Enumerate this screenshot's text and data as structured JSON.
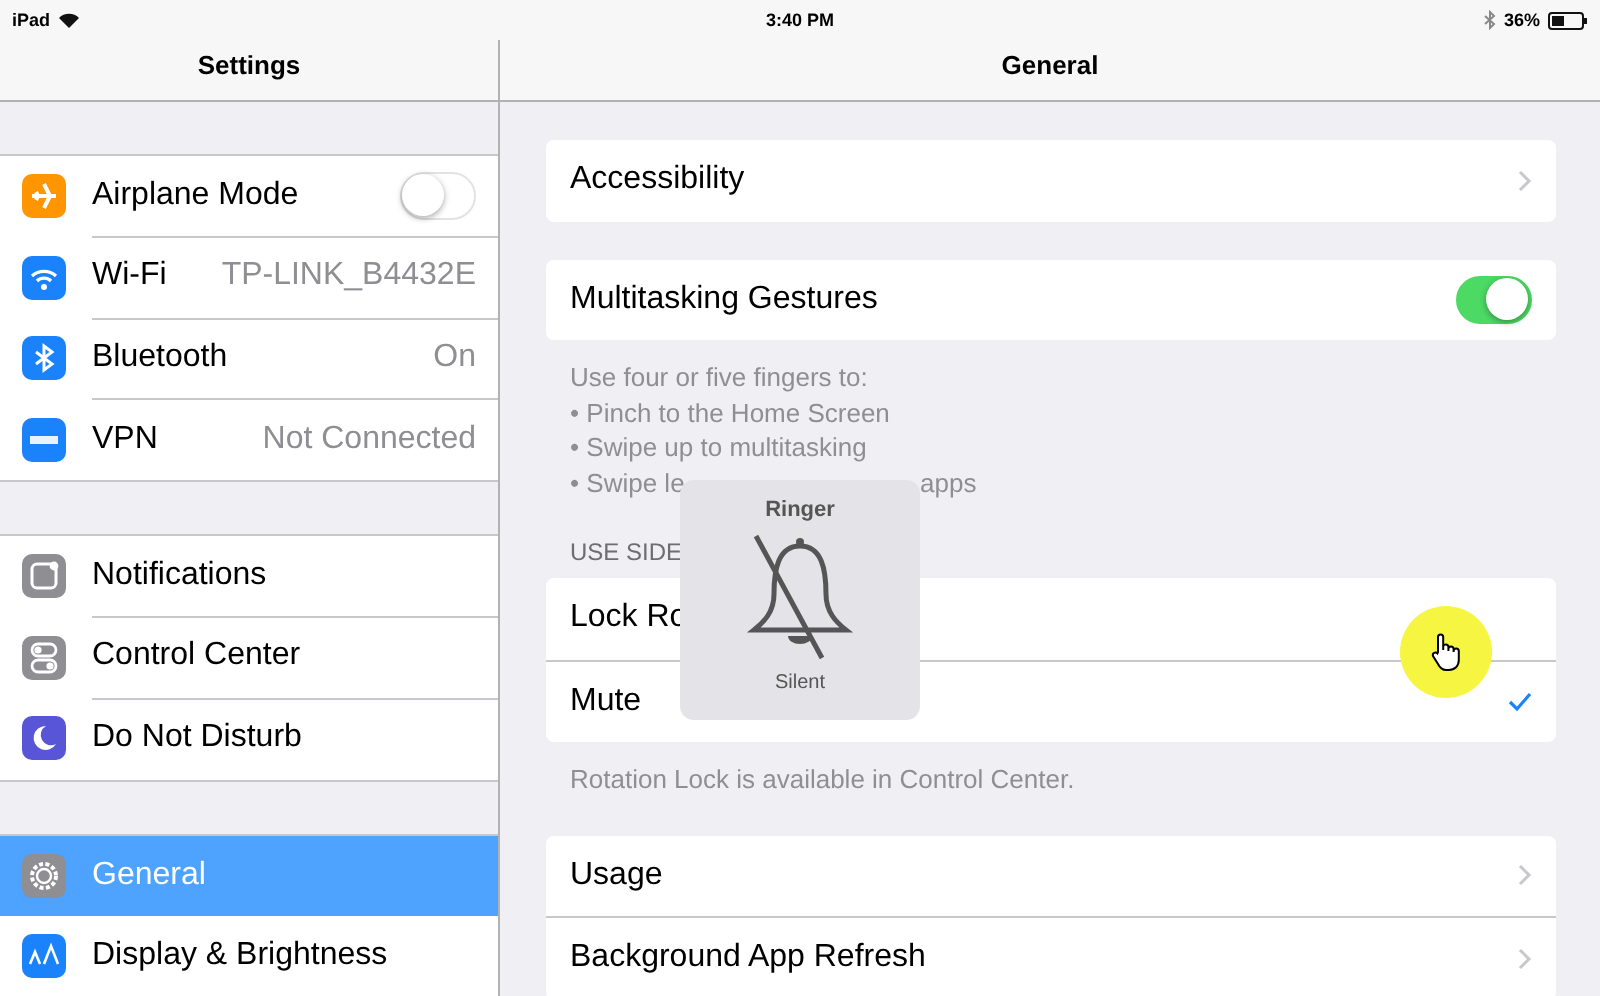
{
  "status_bar": {
    "device": "iPad",
    "time": "3:40 PM",
    "battery": "36%"
  },
  "sidebar": {
    "title": "Settings",
    "groups": [
      [
        {
          "label": "Airplane Mode",
          "kind": "toggle",
          "on": false,
          "color": "#ff9500",
          "selected": false
        },
        {
          "label": "Wi-Fi",
          "kind": "value",
          "value": "TP-LINK_B4432E",
          "color": "#1a82fb",
          "selected": false
        },
        {
          "label": "Bluetooth",
          "kind": "value",
          "value": "On",
          "color": "#1a82fb",
          "selected": false
        },
        {
          "label": "VPN",
          "kind": "value",
          "value": "Not Connected",
          "color": "#1a82fb",
          "selected": false
        }
      ],
      [
        {
          "label": "Notifications",
          "kind": "plain",
          "color": "#8e8e93",
          "selected": false
        },
        {
          "label": "Control Center",
          "kind": "plain",
          "color": "#8e8e93",
          "selected": false
        },
        {
          "label": "Do Not Disturb",
          "kind": "plain",
          "color": "#5856d6",
          "selected": false
        }
      ],
      [
        {
          "label": "General",
          "kind": "plain",
          "color": "#8e8e93",
          "selected": true
        },
        {
          "label": "Display & Brightness",
          "kind": "plain",
          "color": "#1a82fb",
          "selected": false
        }
      ]
    ]
  },
  "detail": {
    "title": "General",
    "groups": [
      {
        "rows": [
          {
            "label": "Accessibility",
            "kind": "chevron"
          }
        ]
      },
      {
        "rows": [
          {
            "label": "Multitasking Gestures",
            "kind": "toggle",
            "on": true
          }
        ],
        "footer_lines": [
          [
            "Use four or five fingers to:"
          ],
          [
            "• Pinch to the Home Screen"
          ],
          [
            "• Swipe up to multitasking"
          ],
          [
            "• Swipe le",
            "apps"
          ]
        ]
      },
      {
        "header": "USE SIDE",
        "rows": [
          {
            "label": "Lock Ro",
            "kind": "check",
            "checked": false
          },
          {
            "label": "Mute",
            "kind": "check",
            "checked": true
          }
        ],
        "footer_lines": [
          [
            "Rotation Lock is available in Control Center."
          ]
        ]
      },
      {
        "rows": [
          {
            "label": "Usage",
            "kind": "chevron"
          },
          {
            "label": "Background App Refresh",
            "kind": "chevron"
          }
        ]
      }
    ]
  },
  "hud": {
    "title": "Ringer",
    "caption": "Silent"
  }
}
